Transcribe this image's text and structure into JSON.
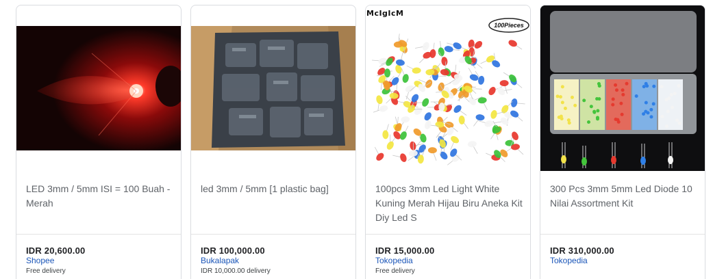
{
  "products": [
    {
      "title": "LED 3mm / 5mm ISI = 100 Buah - Merah",
      "price": "IDR 20,600.00",
      "seller": "Shopee",
      "delivery": "Free delivery",
      "image_icon": "red-led-photo-icon"
    },
    {
      "title": "led 3mm / 5mm [1 plastic bag]",
      "price": "IDR 100,000.00",
      "seller": "Bukalapak",
      "delivery": "IDR 10,000.00 delivery",
      "image_icon": "cardboard-box-photo-icon"
    },
    {
      "title": "100pcs 3mm Led Light White Kuning Merah Hijau Biru Aneka Kit Diy Led S",
      "price": "IDR 15,000.00",
      "seller": "Tokopedia",
      "delivery": "Free delivery",
      "image_icon": "colorful-leds-photo-icon",
      "brand_logo": "McIgIcM",
      "badge": "100Pieces"
    },
    {
      "title": "300 Pcs 3mm 5mm Led Diode 10 Nilai Assortment Kit",
      "price": "IDR 310,000.00",
      "seller": "Tokopedia",
      "image_icon": "led-assortment-box-photo-icon"
    }
  ],
  "colors": {
    "seller_link": "#1a55b8",
    "price": "#202124",
    "title": "#5f6368",
    "border": "#dadce0"
  }
}
